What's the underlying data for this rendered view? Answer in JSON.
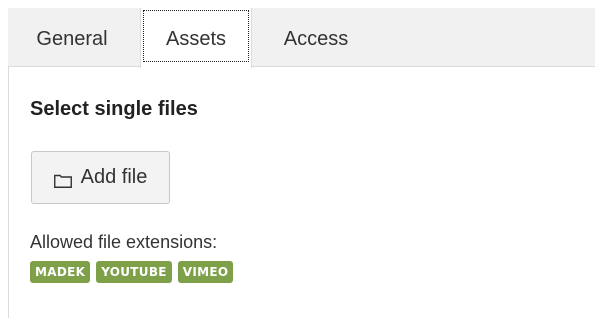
{
  "tabs": [
    {
      "label": "General",
      "active": false
    },
    {
      "label": "Assets",
      "active": true
    },
    {
      "label": "Access",
      "active": false
    }
  ],
  "content": {
    "section_title": "Select single files",
    "add_button": {
      "label": "Add file",
      "icon": "folder-icon"
    },
    "extensions_label": "Allowed file extensions:",
    "extensions": [
      "MADEK",
      "YOUTUBE",
      "VIMEO"
    ]
  },
  "colors": {
    "badge_bg": "#7ea049",
    "tabbar_bg": "#f1f1f1",
    "button_bg": "#f3f3f3"
  }
}
